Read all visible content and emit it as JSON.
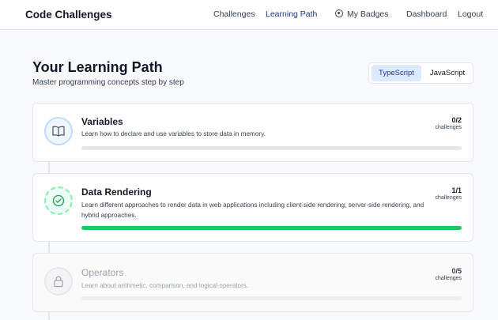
{
  "nav": {
    "brand": "Code Challenges",
    "challenges": "Challenges",
    "learning_path": "Learning Path",
    "my_badges": "My Badges",
    "dashboard": "Dashboard",
    "logout": "Logout"
  },
  "header": {
    "title": "Your Learning Path",
    "subtitle": "Master programming concepts step by step"
  },
  "languages": {
    "typescript": "TypeScript",
    "javascript": "JavaScript",
    "selected": "TypeScript"
  },
  "modules": [
    {
      "title": "Variables",
      "description": "Learn how to declare and use variables to store data in memory.",
      "count": "0/2",
      "count_label": "challenges",
      "progress": 0,
      "status": "open",
      "icon": "book-icon"
    },
    {
      "title": "Data Rendering",
      "description": "Learn different approaches to render data in web applications including client-side rendering, server-side rendering, and hybrid approaches.",
      "count": "1/1",
      "count_label": "challenges",
      "progress": 1,
      "status": "completed",
      "icon": "check-circle-icon"
    },
    {
      "title": "Operators",
      "description": "Learn about arithmetic, comparison, and logical operators.",
      "count": "0/5",
      "count_label": "challenges",
      "progress": 0,
      "status": "locked",
      "icon": "lock-icon"
    }
  ],
  "colors": {
    "accent": "#1e3a8a",
    "success": "#22c55e",
    "toggle_active": "#dbeafe"
  }
}
